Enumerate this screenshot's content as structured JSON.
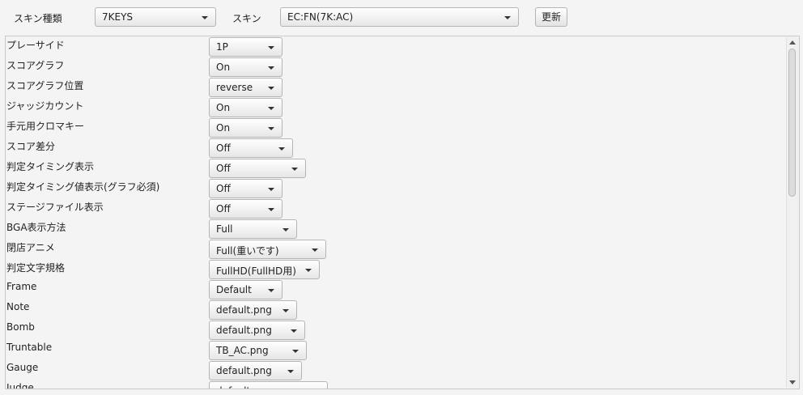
{
  "top": {
    "skin_type_label": "スキン種類",
    "skin_type_value": "7KEYS",
    "skin_label": "スキン",
    "skin_value": "EC:FN(7K:AC)",
    "refresh_label": "更新"
  },
  "options": [
    {
      "name": "プレーサイド",
      "value": "1P"
    },
    {
      "name": "スコアグラフ",
      "value": "On"
    },
    {
      "name": "スコアグラフ位置",
      "value": "reverse"
    },
    {
      "name": "ジャッジカウント",
      "value": "On"
    },
    {
      "name": "手元用クロマキー",
      "value": "On"
    },
    {
      "name": "スコア差分",
      "value": "Off"
    },
    {
      "name": "判定タイミング表示",
      "value": "Off"
    },
    {
      "name": "判定タイミング値表示(グラフ必須)",
      "value": "Off"
    },
    {
      "name": "ステージファイル表示",
      "value": "Off"
    },
    {
      "name": "BGA表示方法",
      "value": "Full"
    },
    {
      "name": "閉店アニメ",
      "value": "Full(重いです)"
    },
    {
      "name": "判定文字規格",
      "value": "FullHD(FullHD用)"
    },
    {
      "name": "Frame",
      "value": "Default"
    },
    {
      "name": "Note",
      "value": "default.png"
    },
    {
      "name": "Bomb",
      "value": "default.png"
    },
    {
      "name": "Truntable",
      "value": "TB_AC.png"
    },
    {
      "name": "Gauge",
      "value": "default.png"
    },
    {
      "name": "Judge",
      "value": "default"
    }
  ]
}
